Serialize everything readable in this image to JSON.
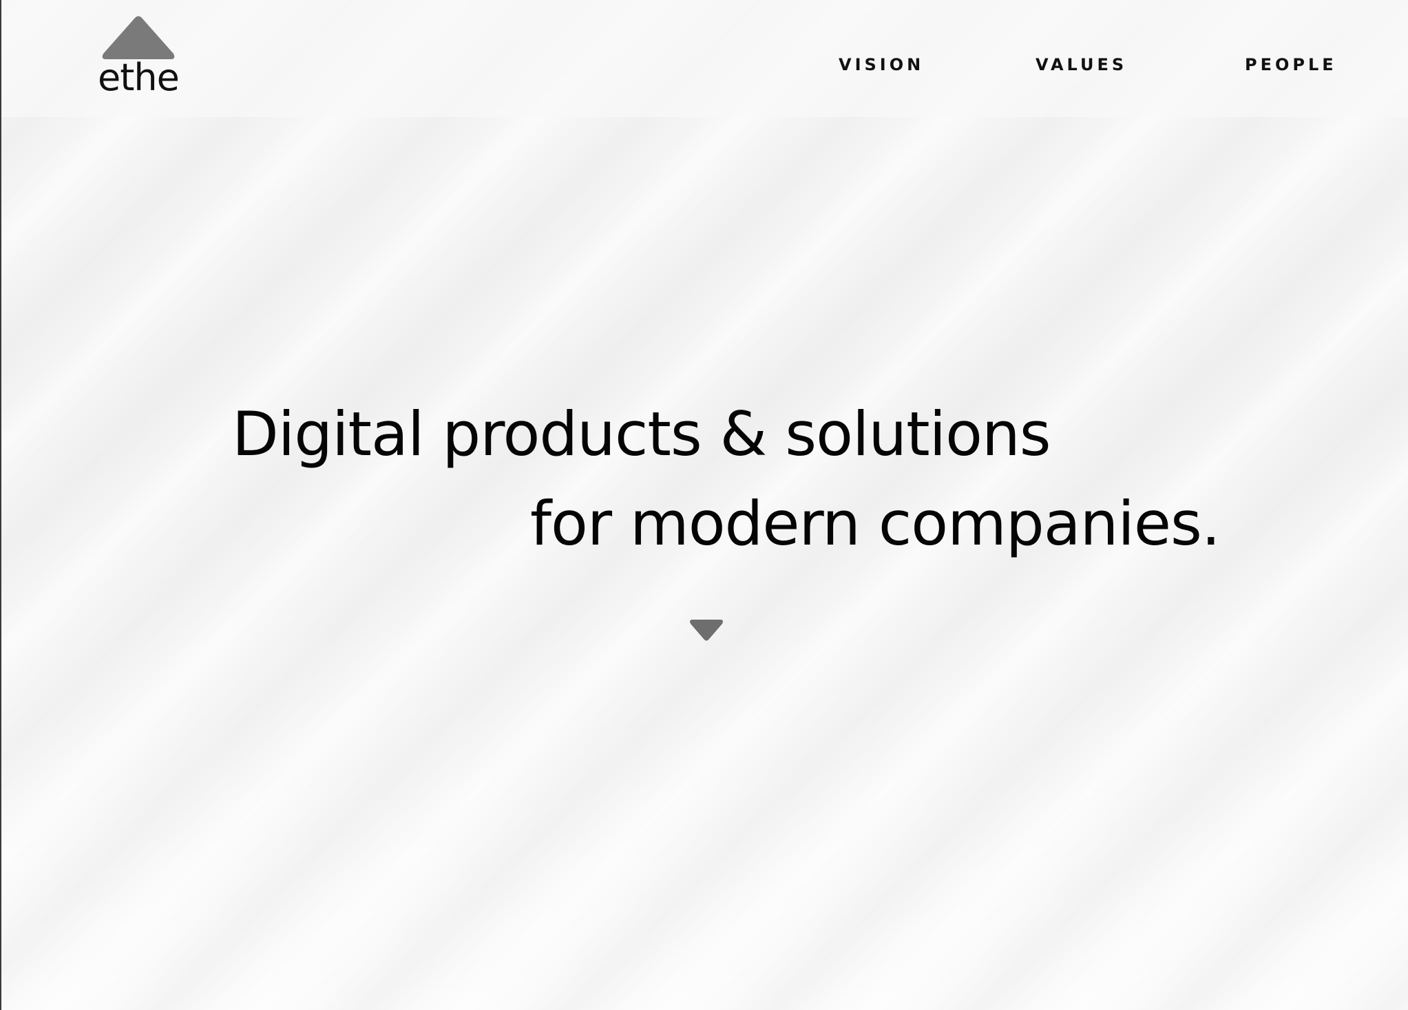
{
  "header": {
    "logo": {
      "text": "ethe",
      "icon": "triangle-up-icon",
      "icon_color": "#7a7a7a"
    },
    "nav": [
      {
        "label": "VISION"
      },
      {
        "label": "VALUES"
      },
      {
        "label": "PEOPLE"
      }
    ]
  },
  "hero": {
    "line1": "Digital products & solutions",
    "line2": "for modern companies.",
    "scroll_icon": "triangle-down-icon",
    "scroll_icon_color": "#6e6e6e"
  },
  "colors": {
    "background": "#f5f5f5",
    "text": "#000000",
    "accent_gray": "#777777"
  }
}
